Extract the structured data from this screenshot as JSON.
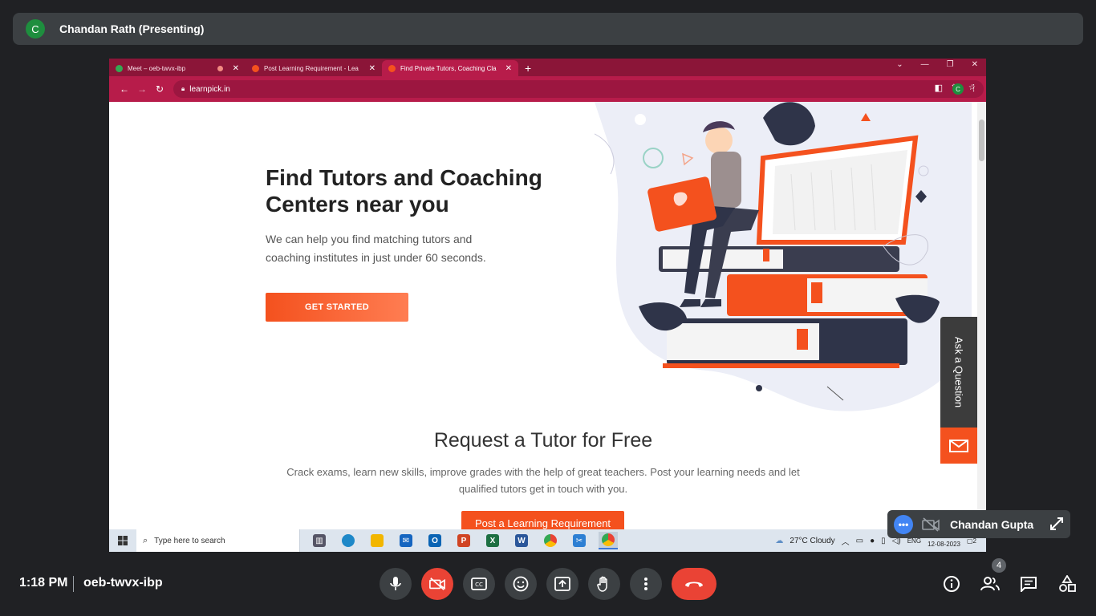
{
  "presenter": {
    "initial": "C",
    "name": "Chandan Rath (Presenting)"
  },
  "browser": {
    "tabs": [
      {
        "title": "Meet – oeb-twvx-ibp",
        "favicon_color": "#34a853",
        "recording": true,
        "active": false
      },
      {
        "title": "Post Learning Requirement - Lea",
        "favicon_color": "#f4511e",
        "active": false
      },
      {
        "title": "Find Private Tutors, Coaching Cla",
        "favicon_color": "#f4511e",
        "active": true
      }
    ],
    "new_tab_glyph": "+",
    "url": "learnpick.in",
    "profile_initial": "C"
  },
  "page": {
    "hero_title": "Find Tutors and Coaching Centers near you",
    "hero_subtitle": "We can help you find matching tutors and coaching institutes in just under 60 seconds.",
    "cta_label": "GET STARTED",
    "request_title": "Request a Tutor for Free",
    "request_text": "Crack exams, learn new skills, improve grades with the help of great teachers. Post your learning needs and let qualified tutors get in touch with you.",
    "post_button": "Post a Learning Requirement",
    "ask_label": "Ask a Question"
  },
  "taskbar": {
    "search_placeholder": "Type here to search",
    "weather": "27°C  Cloudy",
    "lang": "ENG",
    "date": "12-08-2023",
    "notifications": "2"
  },
  "meet": {
    "time": "1:18 PM",
    "meeting_code": "oeb-twvx-ibp",
    "self_name": "Chandan Gupta",
    "participants_count": "4"
  },
  "colors": {
    "brand": "#b71c4a",
    "accent": "#f4511e",
    "end_call": "#ea4335"
  }
}
